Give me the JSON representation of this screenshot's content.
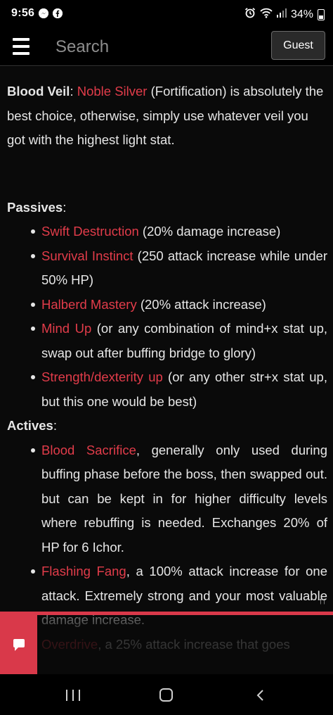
{
  "status_bar": {
    "time": "9:56",
    "app_icons": [
      "messenger-icon",
      "facebook-icon"
    ],
    "battery": "34%",
    "right_icons": [
      "alarm-icon",
      "wifi-icon",
      "signal-icon",
      "battery-icon"
    ]
  },
  "header": {
    "search_placeholder": "Search",
    "guest_label": "Guest"
  },
  "content": {
    "blood_veil": {
      "label": "Blood Veil",
      "colon": ": ",
      "link": "Noble Silver",
      "text": " (Fortification) is absolutely the best choice, otherwise, simply use whatever veil you got with the highest light stat."
    },
    "passives": {
      "heading": "Passives",
      "colon": ":",
      "items": [
        {
          "link": "Swift Destruction",
          "text": " (20% damage increase)"
        },
        {
          "link": "Survival Instinct",
          "text": " (250 attack increase while under 50% HP)"
        },
        {
          "link": "Halberd Mastery",
          "text": " (20% attack increase)"
        },
        {
          "link": "Mind Up",
          "text": " (or any combination of mind+x stat up, swap out after buffing bridge to glory)"
        },
        {
          "link": "Strength/dexterity up",
          "text": " (or any other str+x stat up, but this one would be best)"
        }
      ]
    },
    "actives": {
      "heading": "Actives",
      "colon": ":",
      "items": [
        {
          "link": "Blood Sacrifice",
          "text": ", generally only used during buffing phase before the boss, then swapped out. but can be kept in for higher difficulty levels where rebuffing is needed. Exchanges 20% of HP for 6 Ichor."
        },
        {
          "link": "Flashing Fang",
          "text": ", a 100% attack increase for one attack. Extremely strong and your most valuable damage increase."
        },
        {
          "link": "Overdrive",
          "text": ", a 25% attack increase that goes"
        }
      ]
    }
  },
  "ad": {
    "close_label": "↑↑"
  },
  "colors": {
    "link": "#e23c4a",
    "accent": "#d9394a",
    "background": "#0a0a0a",
    "text": "#e6e6e6"
  }
}
